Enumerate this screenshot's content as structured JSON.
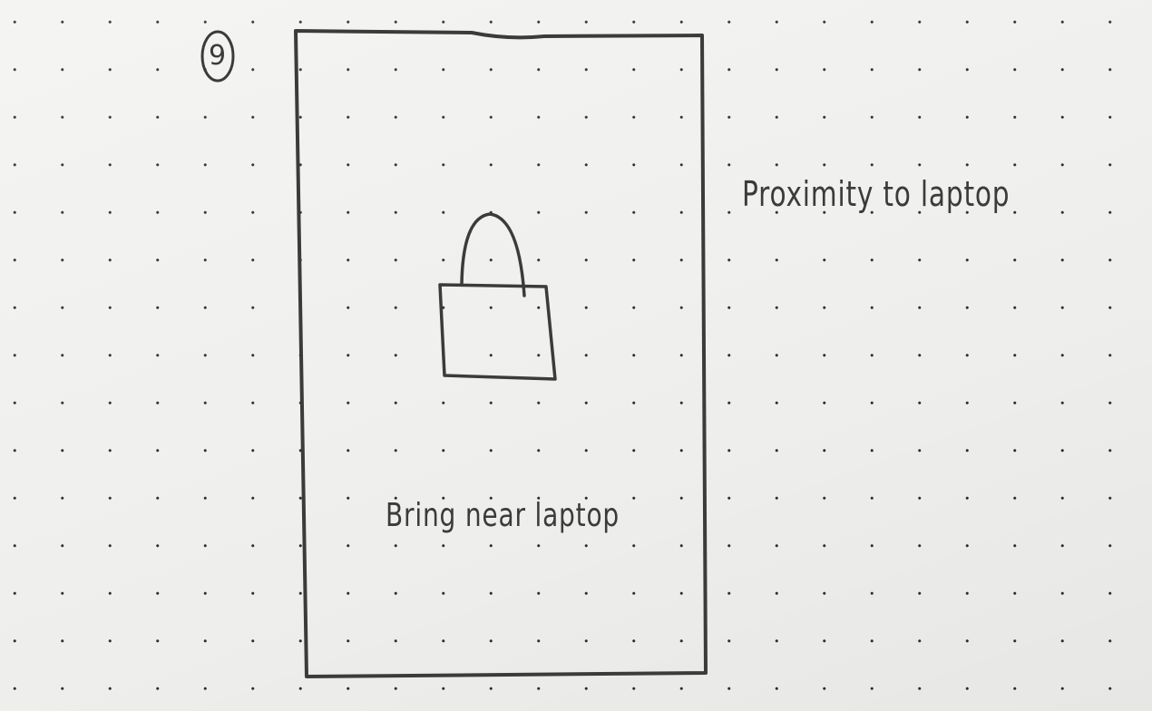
{
  "page_number": "9",
  "screen": {
    "lock_icon": "lock-icon",
    "prompt": "Bring near laptop"
  },
  "annotation": "Proximity to laptop",
  "colors": {
    "ink": "#3b3b3b",
    "paper": "#f3f3f1",
    "dots": "#2e2e2e"
  }
}
